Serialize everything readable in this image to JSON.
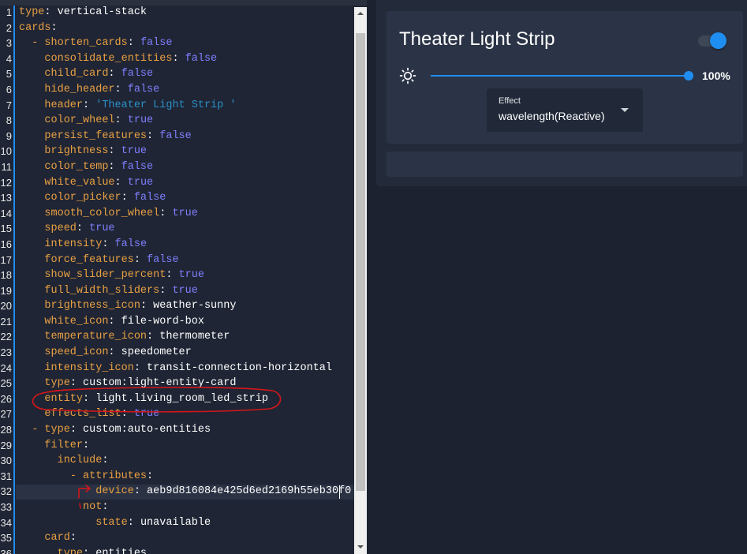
{
  "colors": {
    "accent": "#1f8ef1",
    "yaml_key": "#e9a043",
    "yaml_bool": "#7f7fff",
    "yaml_string": "#2b8fc8",
    "yaml_text": "#ffffff",
    "annotation": "#d3161b"
  },
  "editor": {
    "lines": [
      {
        "num": "1",
        "text": "type: vertical-stack"
      },
      {
        "num": "2",
        "text": "cards:"
      },
      {
        "num": "3",
        "text": "  - shorten_cards: false"
      },
      {
        "num": "4",
        "text": "    consolidate_entities: false"
      },
      {
        "num": "5",
        "text": "    child_card: false"
      },
      {
        "num": "6",
        "text": "    hide_header: false"
      },
      {
        "num": "7",
        "text": "    header: 'Theater Light Strip '"
      },
      {
        "num": "8",
        "text": "    color_wheel: true"
      },
      {
        "num": "9",
        "text": "    persist_features: false"
      },
      {
        "num": "10",
        "text": "    brightness: true"
      },
      {
        "num": "11",
        "text": "    color_temp: false"
      },
      {
        "num": "12",
        "text": "    white_value: true"
      },
      {
        "num": "13",
        "text": "    color_picker: false"
      },
      {
        "num": "14",
        "text": "    smooth_color_wheel: true"
      },
      {
        "num": "15",
        "text": "    speed: true"
      },
      {
        "num": "16",
        "text": "    intensity: false"
      },
      {
        "num": "17",
        "text": "    force_features: false"
      },
      {
        "num": "18",
        "text": "    show_slider_percent: true"
      },
      {
        "num": "19",
        "text": "    full_width_sliders: true"
      },
      {
        "num": "20",
        "text": "    brightness_icon: weather-sunny"
      },
      {
        "num": "21",
        "text": "    white_icon: file-word-box"
      },
      {
        "num": "22",
        "text": "    temperature_icon: thermometer"
      },
      {
        "num": "23",
        "text": "    speed_icon: speedometer"
      },
      {
        "num": "24",
        "text": "    intensity_icon: transit-connection-horizontal"
      },
      {
        "num": "25",
        "text": "    type: custom:light-entity-card"
      },
      {
        "num": "26",
        "text": "    entity: light.living_room_led_strip"
      },
      {
        "num": "27",
        "text": "    effects_list: true"
      },
      {
        "num": "28",
        "text": "  - type: custom:auto-entities"
      },
      {
        "num": "29",
        "text": "    filter:"
      },
      {
        "num": "30",
        "text": "      include:"
      },
      {
        "num": "31",
        "text": "        - attributes:"
      },
      {
        "num": "32",
        "text": "            device: aeb9d816084e425d6ed2169h55eb30f0"
      },
      {
        "num": "33",
        "text": "          not:"
      },
      {
        "num": "34",
        "text": "            state: unavailable"
      },
      {
        "num": "35",
        "text": "    card:"
      },
      {
        "num": "36",
        "text": "      type: entities"
      }
    ]
  },
  "preview": {
    "light_card": {
      "title": "Theater Light Strip",
      "toggle_on": true,
      "brightness": {
        "icon": "weather-sunny",
        "level": 100,
        "label": "100%"
      },
      "effect": {
        "label": "Effect",
        "selected": "wavelength(Reactive)",
        "icon": "menu-down"
      }
    }
  }
}
